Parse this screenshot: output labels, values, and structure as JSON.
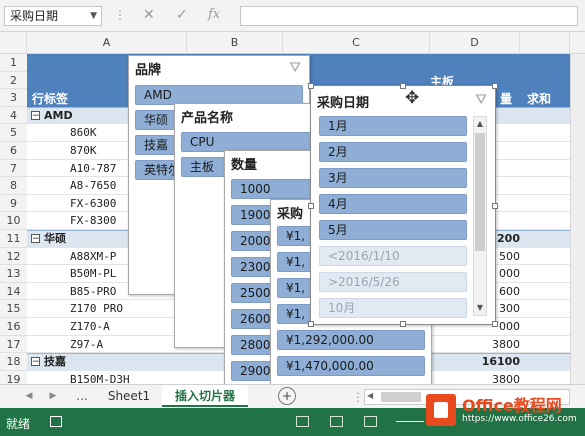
{
  "formula_bar": {
    "name_box": "采购日期",
    "fx": "fx",
    "cancel_icon": "✕",
    "enter_icon": "✓",
    "sep": "⋮"
  },
  "columns": [
    "A",
    "B",
    "C",
    "D"
  ],
  "rows": [
    "1",
    "2",
    "3",
    "4",
    "5",
    "6",
    "7",
    "8",
    "9",
    "10",
    "11",
    "12",
    "13",
    "14",
    "15",
    "16",
    "17",
    "18",
    "19"
  ],
  "pivot": {
    "row_label": "行标签",
    "c2_label": "主板",
    "d3_text": "量",
    "e3_text": "求和",
    "groups": [
      {
        "name": "AMD",
        "row": 4
      },
      {
        "name": "华硕",
        "row": 11
      },
      {
        "name": "技嘉",
        "row": 18
      }
    ],
    "items": [
      {
        "row": 5,
        "name": "860K"
      },
      {
        "row": 6,
        "name": "870K"
      },
      {
        "row": 7,
        "name": "A10-787"
      },
      {
        "row": 8,
        "name": "A8-7650"
      },
      {
        "row": 9,
        "name": "FX-6300"
      },
      {
        "row": 10,
        "name": "FX-8300"
      },
      {
        "row": 12,
        "name": "A88XM-P"
      },
      {
        "row": 13,
        "name": "B50M-PL"
      },
      {
        "row": 14,
        "name": "B85-PRO"
      },
      {
        "row": 15,
        "name": "Z170 PRO"
      },
      {
        "row": 16,
        "name": "Z170-A"
      },
      {
        "row": 17,
        "name": "Z97-A"
      },
      {
        "row": 19,
        "name": "B150M-D3H"
      }
    ],
    "d_values": [
      {
        "row": 11,
        "value": "200",
        "bold": true
      },
      {
        "row": 12,
        "value": "500"
      },
      {
        "row": 13,
        "value": "000"
      },
      {
        "row": 14,
        "value": "600"
      },
      {
        "row": 15,
        "value": "300"
      },
      {
        "row": 16,
        "value": "000"
      },
      {
        "row": 17,
        "value": "3800"
      },
      {
        "row": 18,
        "value": "16100",
        "bold": true
      },
      {
        "row": 19,
        "value": "3800"
      }
    ]
  },
  "slicers": {
    "brand": {
      "title": "品牌",
      "items": [
        "AMD",
        "华硕",
        "技嘉",
        "英特尔"
      ]
    },
    "product": {
      "title": "产品名称",
      "items": [
        "CPU",
        "主板"
      ]
    },
    "quantity": {
      "title": "数量",
      "items": [
        "1000",
        "1900",
        "2000",
        "2300",
        "2500",
        "2600",
        "2800",
        "2900"
      ]
    },
    "price": {
      "title": "采购",
      "items": [
        "¥1,",
        "¥1,",
        "¥1,",
        "¥1,",
        "¥1,292,000.00",
        "¥1,470,000.00"
      ]
    },
    "date": {
      "title": "采购日期",
      "items": [
        {
          "label": "1月",
          "dim": false
        },
        {
          "label": "2月",
          "dim": false
        },
        {
          "label": "3月",
          "dim": false
        },
        {
          "label": "4月",
          "dim": false
        },
        {
          "label": "5月",
          "dim": false
        },
        {
          "label": "<2016/1/10",
          "dim": true
        },
        {
          "label": ">2016/5/26",
          "dim": true
        },
        {
          "label": "10月",
          "dim": true
        }
      ]
    }
  },
  "tabs": {
    "prev": "◀",
    "next": "▶",
    "more": "...",
    "sheet1": "Sheet1",
    "active": "插入切片器",
    "add": "+"
  },
  "status": {
    "ready": "就绪",
    "watermark": "Office教程网",
    "url": "https://www.office26.com"
  },
  "colors": {
    "slicer_item": "#8eaed6",
    "slicer_item_dim": "#e1e9f2",
    "pivot_header": "#4f81bd",
    "status_bar": "#217346"
  }
}
